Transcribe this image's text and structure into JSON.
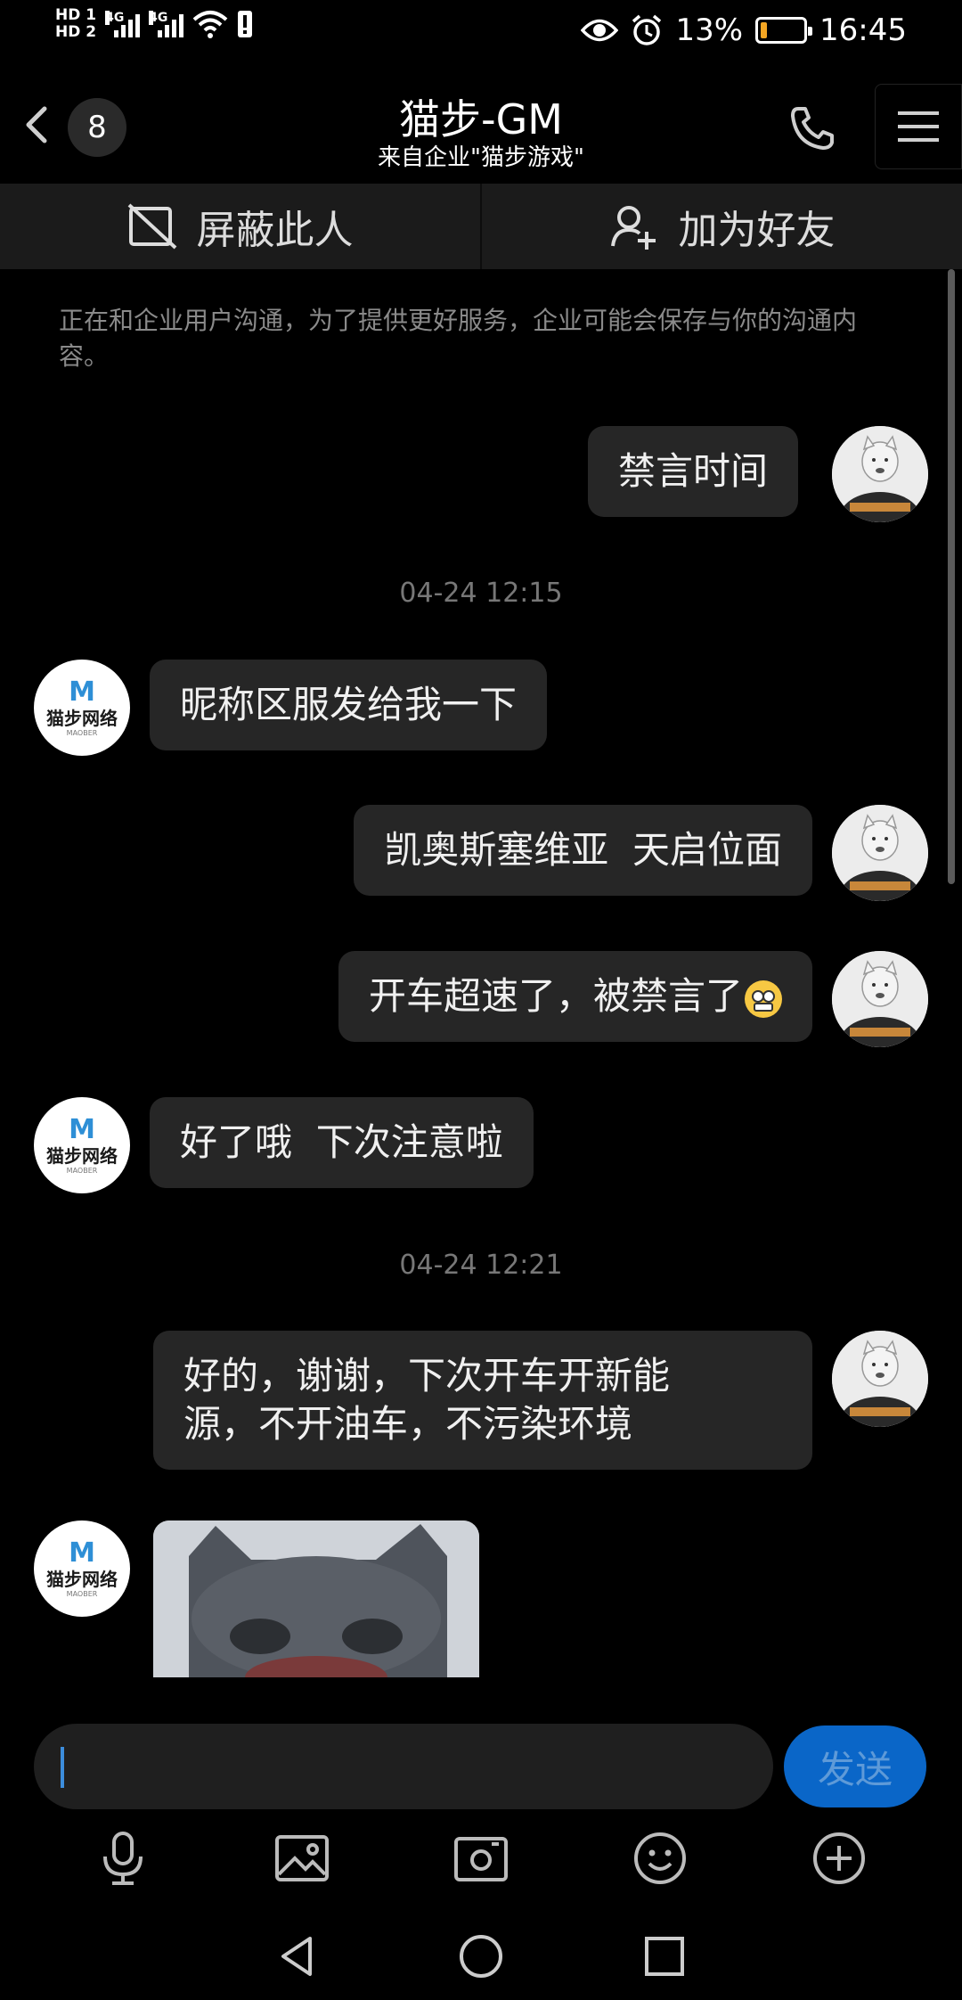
{
  "status_bar": {
    "sim1": "HD 1",
    "sim2": "HD 2",
    "net1": "4G",
    "net2": "4G",
    "battery_percent": "13%",
    "battery_level": 0.13,
    "time": "16:45"
  },
  "header": {
    "unread_count": "8",
    "title": "猫步-GM",
    "subtitle": "来自企业\"猫步游戏\""
  },
  "actions": {
    "block_label": "屏蔽此人",
    "add_friend_label": "加为好友"
  },
  "notice": "正在和企业用户沟通，为了提供更好服务，企业可能会保存与你的沟通内容。",
  "messages": {
    "m1": "禁言时间",
    "t1": "04-24 12:15",
    "m2": "昵称区服发给我一下",
    "m3": "凯奥斯塞维亚  天启位面",
    "m4": "开车超速了，被禁言了",
    "m5": "好了哦  下次注意啦",
    "t2": "04-24 12:21",
    "m6": "好的，谢谢，下次开车开新能\n源，不开油车，不污染环境"
  },
  "brand_avatar": {
    "name": "猫步网络",
    "sub": "MAOBER"
  },
  "input": {
    "value": "",
    "send_label": "发送"
  },
  "colors": {
    "background": "#000000",
    "bubble": "#262626",
    "send_button": "#0a66c8",
    "brand_blue": "#2e8fd6"
  }
}
